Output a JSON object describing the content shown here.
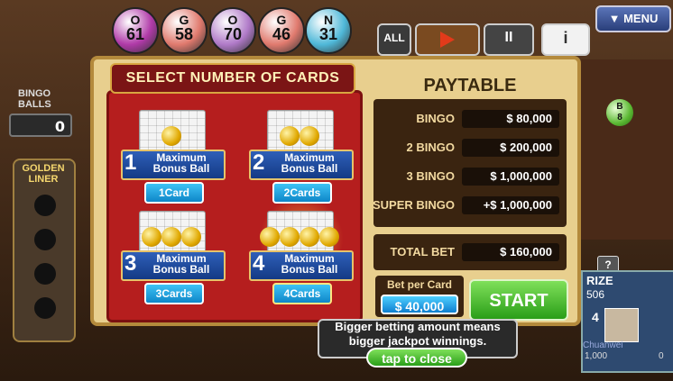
{
  "header": {
    "balls": [
      {
        "letter": "O",
        "number": "61",
        "color": "#b03aa8"
      },
      {
        "letter": "G",
        "number": "58",
        "color": "#e07a6e"
      },
      {
        "letter": "O",
        "number": "70",
        "color": "#b07ac8"
      },
      {
        "letter": "G",
        "number": "46",
        "color": "#e07a6e"
      },
      {
        "letter": "N",
        "number": "31",
        "color": "#4fb8d8"
      }
    ],
    "all_label": "ALL",
    "menu_label": "▼ MENU",
    "info_label": "i",
    "pause_label": "II"
  },
  "left_panel": {
    "bingo_balls_label": "BINGO BALLS",
    "balls_count": "0",
    "golden_liner_label": "GOLDEN LINER"
  },
  "card_select": {
    "title": "SELECT NUMBER OF CARDS",
    "options": [
      {
        "number": "1",
        "bonus_text": "Maximum Bonus Ball",
        "button": "1Card",
        "selected": false
      },
      {
        "number": "2",
        "bonus_text": "Maximum Bonus Ball",
        "button": "2Cards",
        "selected": false
      },
      {
        "number": "3",
        "bonus_text": "Maximum Bonus Ball",
        "button": "3Cards",
        "selected": false
      },
      {
        "number": "4",
        "bonus_text": "Maximum Bonus Ball",
        "button": "4Cards",
        "selected": true
      }
    ]
  },
  "paytable": {
    "title": "PAYTABLE",
    "rows": [
      {
        "label": "BINGO",
        "value": "$ 80,000"
      },
      {
        "label": "2 BINGO",
        "value": "$ 200,000"
      },
      {
        "label": "3 BINGO",
        "value": "$ 1,000,000"
      },
      {
        "label": "SUPER BINGO",
        "value": "+$ 1,000,000"
      }
    ],
    "total_bet_label": "TOTAL BET",
    "total_bet_value": "$ 160,000"
  },
  "bet": {
    "label": "Bet per Card",
    "value": "$ 40,000",
    "start_label": "START"
  },
  "tooltip": {
    "text_line1": "Bigger betting amount means",
    "text_line2": "bigger jackpot winnings.",
    "close_label": "tap to close"
  },
  "right_panel": {
    "prize_label": "RIZE",
    "prize_value": "506",
    "player_rank": "4",
    "player_name": "Chuanwei",
    "player_score": "1,000",
    "help_label": "?",
    "zero_value": "0",
    "ball_letter": "B",
    "ball_number": "8"
  }
}
